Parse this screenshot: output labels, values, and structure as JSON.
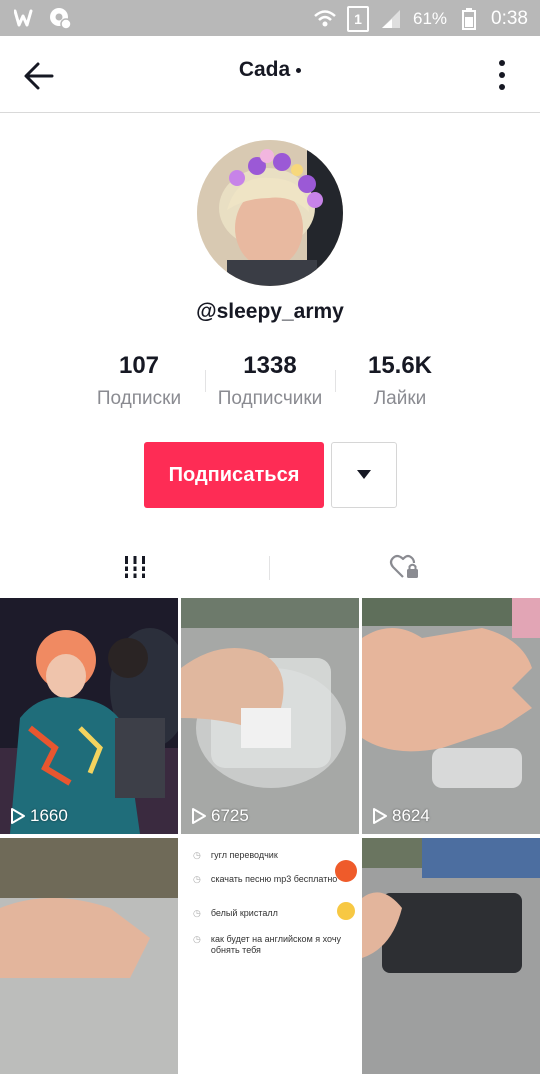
{
  "statusbar": {
    "battery_percent": "61%",
    "time": "0:38",
    "sim_label": "1",
    "left_icons": [
      "wattpad-icon",
      "settings-notification-icon"
    ]
  },
  "topbar": {
    "title": "Cada",
    "back_icon": "arrow-left-icon",
    "menu_icon": "more-vertical-icon"
  },
  "profile": {
    "username": "@sleepy_army",
    "stats": [
      {
        "value": "107",
        "label": "Подписки"
      },
      {
        "value": "1338",
        "label": "Подписчики"
      },
      {
        "value": "15.6K",
        "label": "Лайки"
      }
    ],
    "follow_button": "Подписаться",
    "dropdown_icon": "caret-down-icon"
  },
  "tabs": [
    {
      "name": "videos",
      "icon": "grid-icon",
      "active": true
    },
    {
      "name": "liked",
      "icon": "heart-lock-icon",
      "active": false
    }
  ],
  "videos": [
    {
      "views": "1660"
    },
    {
      "views": "6725"
    },
    {
      "views": "8624"
    },
    {
      "views": ""
    },
    {
      "views": "",
      "search_items": [
        "гугл переводчик",
        "скачать песню mp3 бесплатно",
        "белый кристалл",
        "как будет на английском я хочу обнять тебя"
      ]
    },
    {
      "views": ""
    }
  ],
  "colors": {
    "accent": "#fe2c55",
    "text": "#161823",
    "muted": "#8a8b91",
    "statusbar": "#b8b8b8"
  }
}
